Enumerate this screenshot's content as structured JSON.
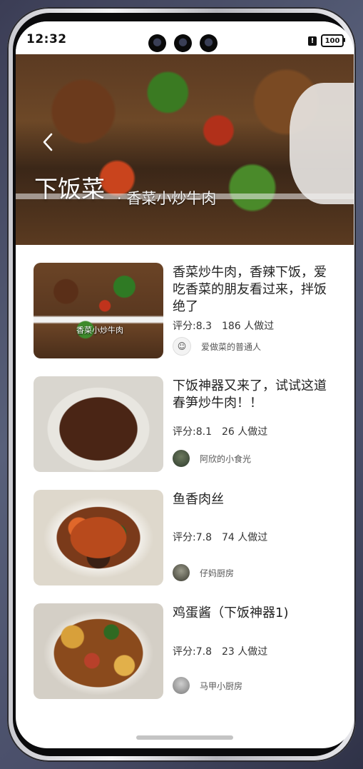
{
  "status_bar": {
    "time": "12:32",
    "battery": "100",
    "alert_icon": "!"
  },
  "header": {
    "back_icon": "chevron-left-icon",
    "title": "下饭菜",
    "subtitle": "· 香菜小炒牛肉"
  },
  "recipes": [
    {
      "title": "香菜炒牛肉，香辣下饭，爱吃香菜的朋友看过来，拌饭绝了",
      "thumb_caption": "香菜小炒牛肉",
      "rating": "评分:8.3",
      "count": "186 人做过",
      "author": "爱做菜的普通人"
    },
    {
      "title": "下饭神器又来了，试试这道春笋炒牛肉！！",
      "rating": "评分:8.1",
      "count": "26 人做过",
      "author": "阿欣的小食光"
    },
    {
      "title": "鱼香肉丝",
      "rating": "评分:7.8",
      "count": "74 人做过",
      "author": "仔妈厨房"
    },
    {
      "title": "鸡蛋酱（下饭神器1)",
      "rating": "评分:7.8",
      "count": "23 人做过",
      "author": "马甲小厨房"
    }
  ]
}
